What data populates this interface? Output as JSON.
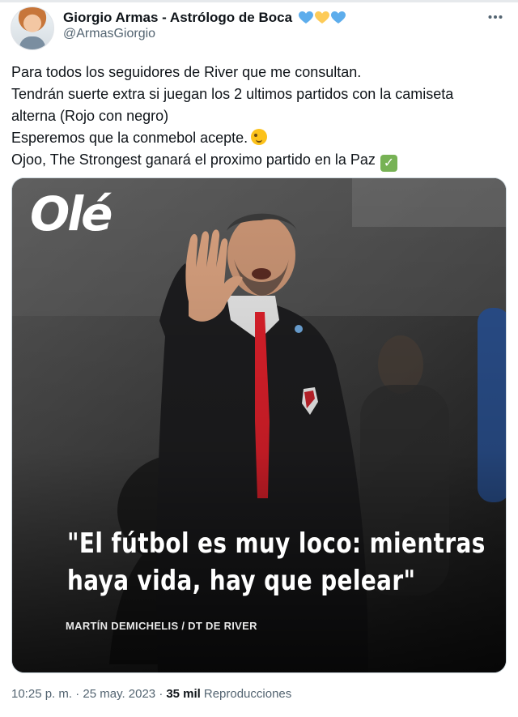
{
  "author": {
    "display_name": "Giorgio Armas - Astrólogo de Boca",
    "handle": "@ArmasGiorgio",
    "name_emojis": [
      "blue-heart",
      "yellow-heart",
      "blue-heart"
    ]
  },
  "tweet": {
    "lines": [
      "Para todos los seguidores de River que me consultan.",
      "Tendrán suerte extra si juegan los 2 ultimos partidos con la camiseta",
      "alterna (Rojo con negro)",
      "Esperemos que la conmebol acepte.",
      "Ojoo, The Strongest ganará el proximo partido en la Paz"
    ],
    "emoji_line4": "winking-face",
    "emoji_line5": "check-mark-button"
  },
  "media": {
    "logo": "Olé",
    "quote_line1": "\"El fútbol es muy loco: mientras",
    "quote_line2": "haya vida, hay que pelear\"",
    "credit": "MARTÍN DEMICHELIS / DT DE RIVER"
  },
  "meta": {
    "timestamp": "10:25 p. m. · 25 may. 2023 ·",
    "views_count": "35 mil",
    "views_label": "Reproducciones"
  },
  "colors": {
    "heart_blue": "#5dadec",
    "heart_yellow": "#fdcb58",
    "secondary_text": "#536471",
    "jersey_red": "#e0202b"
  }
}
